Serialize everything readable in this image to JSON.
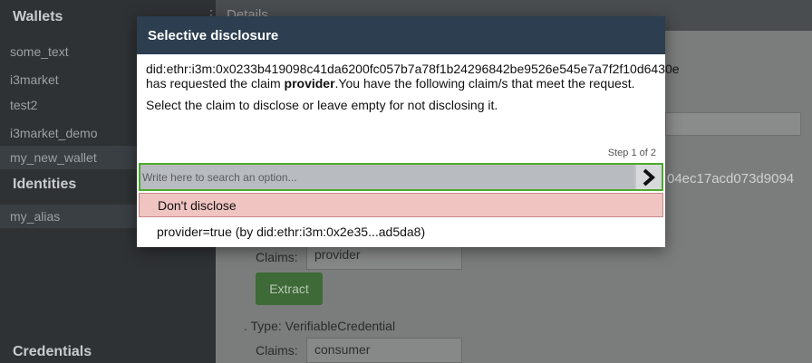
{
  "sidebar": {
    "wallets_title": "Wallets",
    "wallets": [
      {
        "label": "some_text"
      },
      {
        "label": "i3market"
      },
      {
        "label": "test2"
      },
      {
        "label": "i3market_demo"
      },
      {
        "label": "my_new_wallet"
      }
    ],
    "identities_title": "Identities",
    "identities": [
      {
        "label": "my_alias"
      }
    ],
    "credentials_title": "Credentials"
  },
  "main": {
    "header_title": "Details",
    "did_fragment": "04ec17acd073d9094",
    "credential_1": {
      "claims_label": "Claims:",
      "claims_value": "provider",
      "extract_label": "Extract"
    },
    "credential_2": {
      "type_line": "Type: VerifiableCredential",
      "claims_label": "Claims:",
      "claims_value": "consumer"
    }
  },
  "modal": {
    "title": "Selective disclosure",
    "requester_did": "did:ethr:i3m:0x0233b419098c41da6200fc057b7a78f1b24296842be9526e545e7a7f2f10d6430e",
    "request_mid": " has requested the claim ",
    "claim_name": "provider",
    "request_end": ".You have the following claim/s that meet the request.",
    "instruction": "Select the claim to disclose or leave empty for not disclosing it.",
    "step": "Step 1 of 2",
    "search_placeholder": "Write here to search an option...",
    "options": [
      {
        "label": "Don't disclose"
      },
      {
        "label": "provider=true (by did:ethr:i3m:0x2e35...ad5da8)"
      }
    ]
  },
  "colors": {
    "modal_header": "#2c3e50",
    "search_border": "#4caa2c",
    "dont_disclose_bg": "#efc4c1",
    "extract_button": "#3d6a37"
  },
  "icons": {
    "submit": "chevron-right-icon",
    "menu": "vertical-dots-icon"
  }
}
